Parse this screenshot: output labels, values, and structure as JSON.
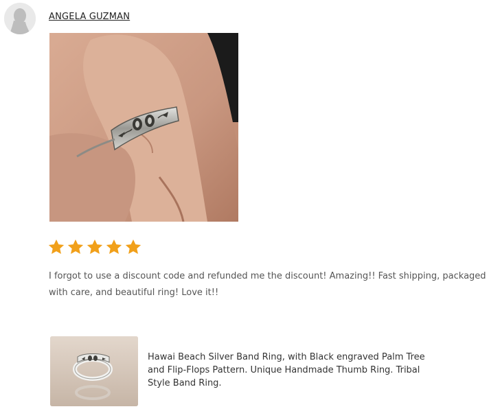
{
  "review": {
    "reviewer_name": "ANGELA GUZMAN",
    "rating": 5,
    "rating_max": 5,
    "star_color": "#f1a01a",
    "text": "I forgot to use a discount code and refunded me the discount! Amazing!! Fast shipping, packaged with care, and beautiful ring! Love it!!"
  },
  "product": {
    "title": "Hawai Beach Silver Band Ring, with Black engraved Palm Tree and Flip-Flops Pattern. Unique Handmade Thumb Ring. Tribal Style Band Ring."
  }
}
